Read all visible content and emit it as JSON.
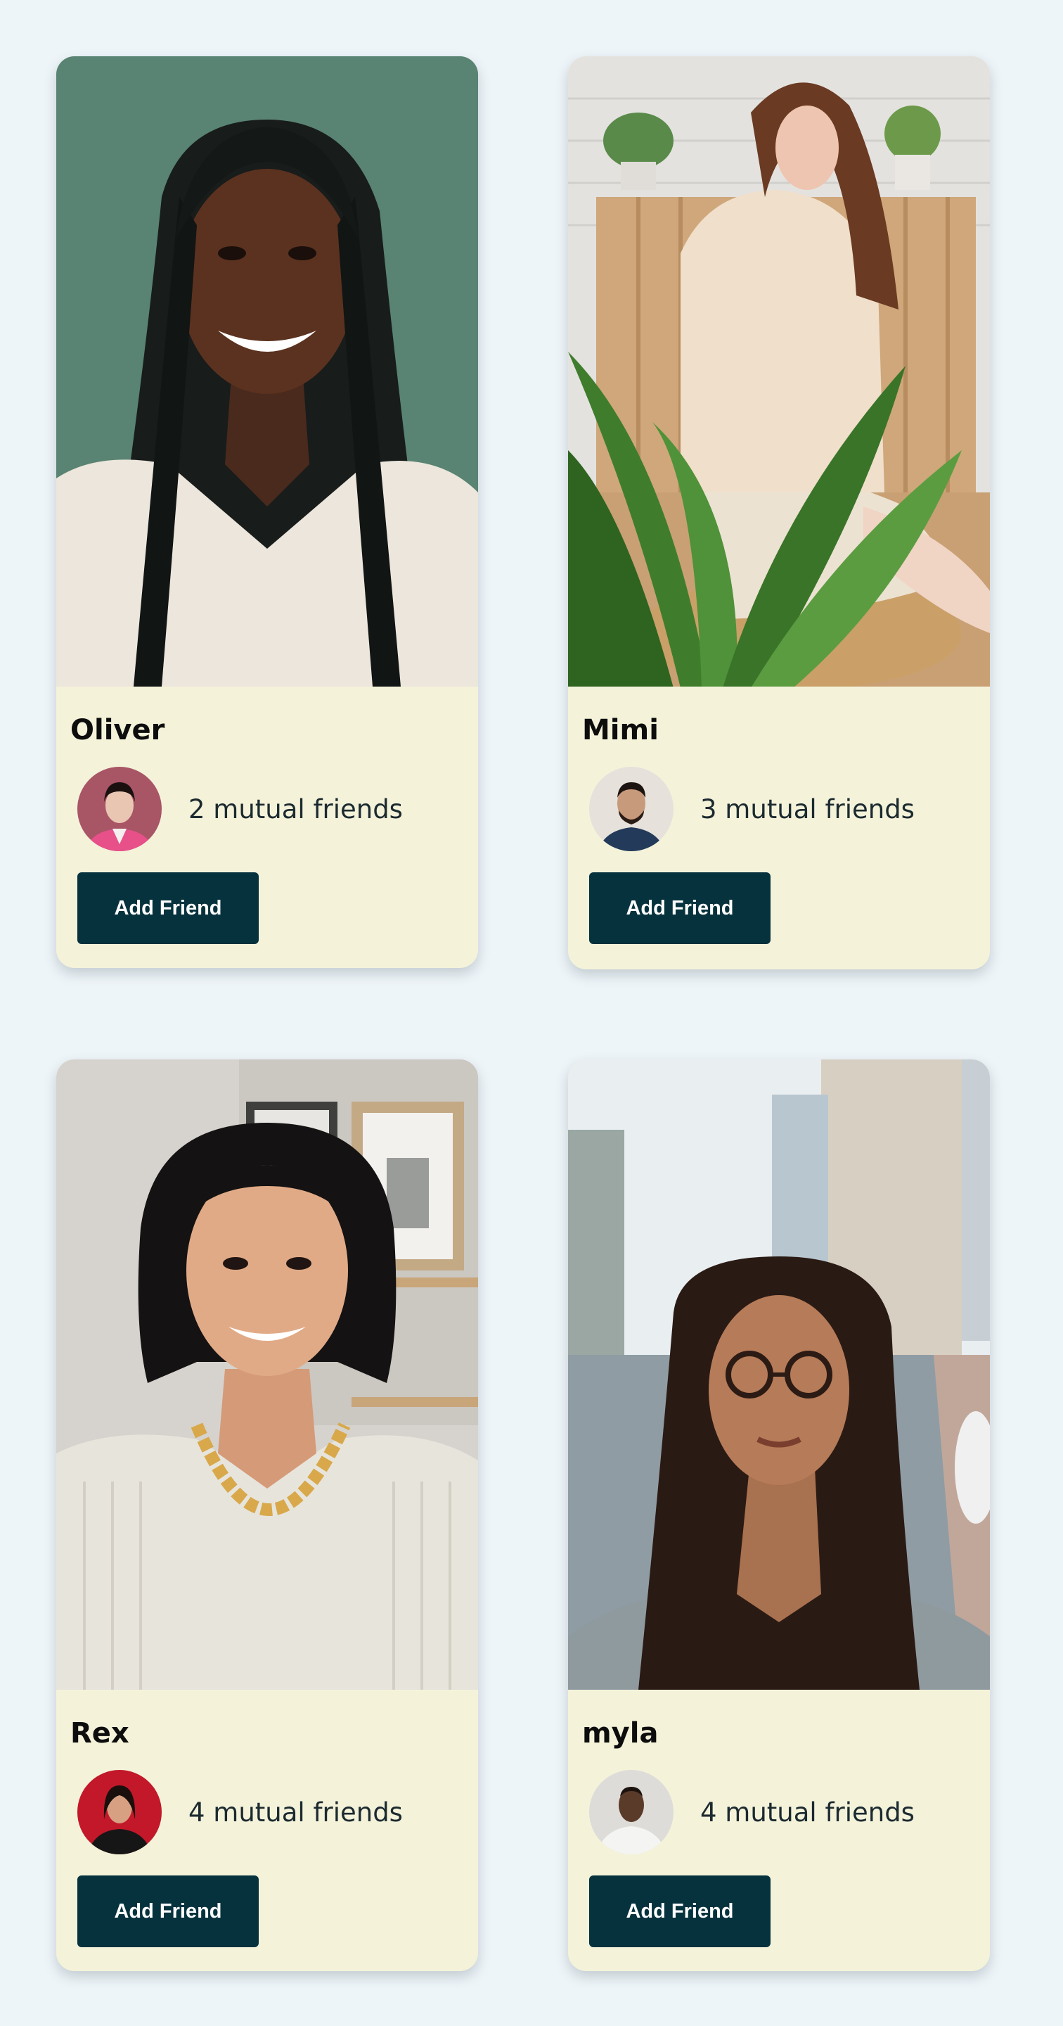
{
  "cards": [
    {
      "name": "Oliver",
      "mutual_text": "2 mutual friends",
      "button_label": "Add Friend",
      "photo": "smiling-woman-braids-portrait",
      "avatar": "woman-pink-blazer-avatar"
    },
    {
      "name": "Mimi",
      "mutual_text": "3 mutual friends",
      "button_label": "Add Friend",
      "photo": "woman-sitting-with-plant-portrait",
      "avatar": "bearded-man-avatar"
    },
    {
      "name": "Rex",
      "mutual_text": "4 mutual friends",
      "button_label": "Add Friend",
      "photo": "smiling-woman-gold-chain-portrait",
      "avatar": "woman-red-background-avatar"
    },
    {
      "name": "myla",
      "mutual_text": "4 mutual friends",
      "button_label": "Add Friend",
      "photo": "woman-glasses-street-portrait",
      "avatar": "man-white-sweater-avatar"
    }
  ],
  "colors": {
    "page_background": "#eef5f9",
    "card_background": "#f4f3da",
    "button_background": "#06323e",
    "button_text": "#ffffff"
  }
}
